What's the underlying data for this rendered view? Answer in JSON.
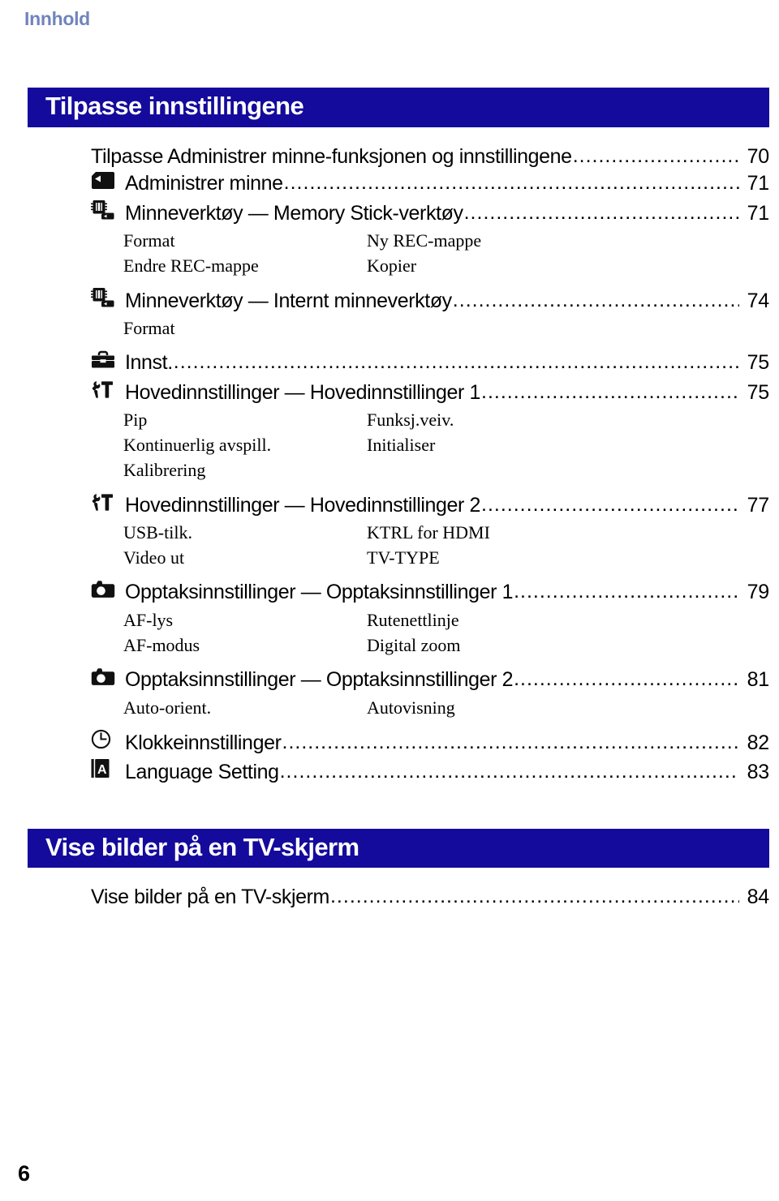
{
  "running_head": "Innhold",
  "folio": "6",
  "colors": {
    "banner_blue": "#140a9c",
    "running_head_blue": "#7084bd",
    "text_black": "#000000"
  },
  "sections": [
    {
      "banner_title": "Tilpasse innstillingene",
      "entries": [
        {
          "icon": "none",
          "label": "Tilpasse Administrer minne-funksjonen og innstillingene",
          "page": "70",
          "subs": []
        },
        {
          "icon": "memory-card-playback-icon",
          "label": "Administrer minne",
          "page": "71",
          "subs": []
        },
        {
          "icon": "memory-stick-tool-icon",
          "label": "Minneverktøy — Memory Stick-verktøy",
          "page": "71",
          "subs": [
            {
              "left": "Format",
              "right": "Ny REC-mappe"
            },
            {
              "left": "Endre REC-mappe",
              "right": "Kopier"
            }
          ]
        },
        {
          "icon": "memory-stick-tool-icon",
          "label": "Minneverktøy — Internt minneverktøy",
          "page": "74",
          "subs": [
            {
              "left": "Format",
              "right": ""
            }
          ]
        },
        {
          "icon": "toolbox-icon",
          "label": "Innst.",
          "page": "75",
          "subs": []
        },
        {
          "icon": "wrench-hammer-icon",
          "label": "Hovedinnstillinger — Hovedinnstillinger 1",
          "page": "75",
          "subs": [
            {
              "left": "Pip",
              "right": "Funksj.veiv."
            },
            {
              "left": "Kontinuerlig avspill.",
              "right": "Initialiser"
            },
            {
              "left": "Kalibrering",
              "right": ""
            }
          ]
        },
        {
          "icon": "wrench-hammer-icon",
          "label": "Hovedinnstillinger — Hovedinnstillinger 2",
          "page": "77",
          "subs": [
            {
              "left": "USB-tilk.",
              "right": "KTRL for HDMI"
            },
            {
              "left": "Video ut",
              "right": "TV-TYPE"
            }
          ]
        },
        {
          "icon": "camera-icon",
          "label": "Opptaksinnstillinger — Opptaksinnstillinger 1",
          "page": "79",
          "subs": [
            {
              "left": "AF-lys",
              "right": "Rutenettlinje"
            },
            {
              "left": "AF-modus",
              "right": "Digital zoom"
            }
          ]
        },
        {
          "icon": "camera-icon",
          "label": "Opptaksinnstillinger — Opptaksinnstillinger 2",
          "page": "81",
          "subs": [
            {
              "left": "Auto-orient.",
              "right": "Autovisning"
            }
          ]
        },
        {
          "icon": "clock-icon",
          "label": "Klokkeinnstillinger",
          "page": "82",
          "subs": []
        },
        {
          "icon": "language-book-icon",
          "label": "Language Setting",
          "page": "83",
          "subs": []
        }
      ]
    },
    {
      "banner_title": "Vise bilder på en TV-skjerm",
      "entries": [
        {
          "icon": "none",
          "label": "Vise bilder på en TV-skjerm",
          "page": "84",
          "subs": []
        }
      ]
    }
  ]
}
